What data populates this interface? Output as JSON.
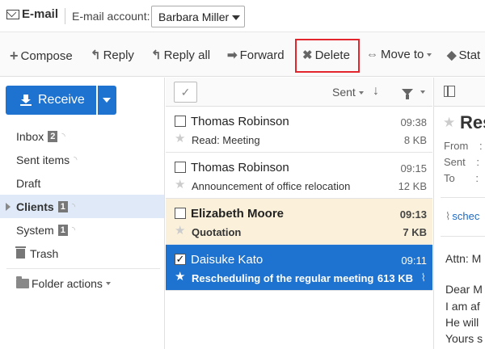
{
  "app": {
    "title": "E-mail"
  },
  "account": {
    "label": "E-mail account:",
    "selected": "Barbara Miller"
  },
  "toolbar": {
    "compose": "Compose",
    "reply": "Reply",
    "reply_all": "Reply all",
    "forward": "Forward",
    "delete": "Delete",
    "move_to": "Move to",
    "status": "Stat"
  },
  "sidebar": {
    "receive_label": "Receive",
    "folders": [
      {
        "label": "Inbox",
        "count": "2"
      },
      {
        "label": "Sent items",
        "count": ""
      },
      {
        "label": "Draft",
        "count": ""
      },
      {
        "label": "Clients",
        "count": "1"
      },
      {
        "label": "System",
        "count": "1"
      },
      {
        "label": "Trash",
        "count": ""
      }
    ],
    "folder_actions": "Folder actions"
  },
  "list": {
    "sort_label": "Sent",
    "rows": [
      {
        "sender": "Thomas Robinson",
        "subject": "Read: Meeting",
        "time": "09:38",
        "size": "8 KB"
      },
      {
        "sender": "Thomas Robinson",
        "subject": "Announcement of office relocation",
        "time": "09:15",
        "size": "12 KB"
      },
      {
        "sender": "Elizabeth Moore",
        "subject": "Quotation",
        "time": "09:13",
        "size": "7 KB"
      },
      {
        "sender": "Daisuke Kato",
        "subject": "Rescheduling of the regular meeting",
        "time": "09:11",
        "size": "613 KB"
      }
    ]
  },
  "preview": {
    "title": "Res",
    "from_label": "From",
    "sent_label": "Sent",
    "to_label": "To",
    "colon": ":",
    "attachment": "schec",
    "body": [
      "Attn: M",
      "Dear M",
      "I am af",
      "He will",
      "Yours s"
    ]
  },
  "colors": {
    "accent": "#1e73d0",
    "unread_bg": "#fbf1da",
    "highlight": "#e3262d"
  }
}
